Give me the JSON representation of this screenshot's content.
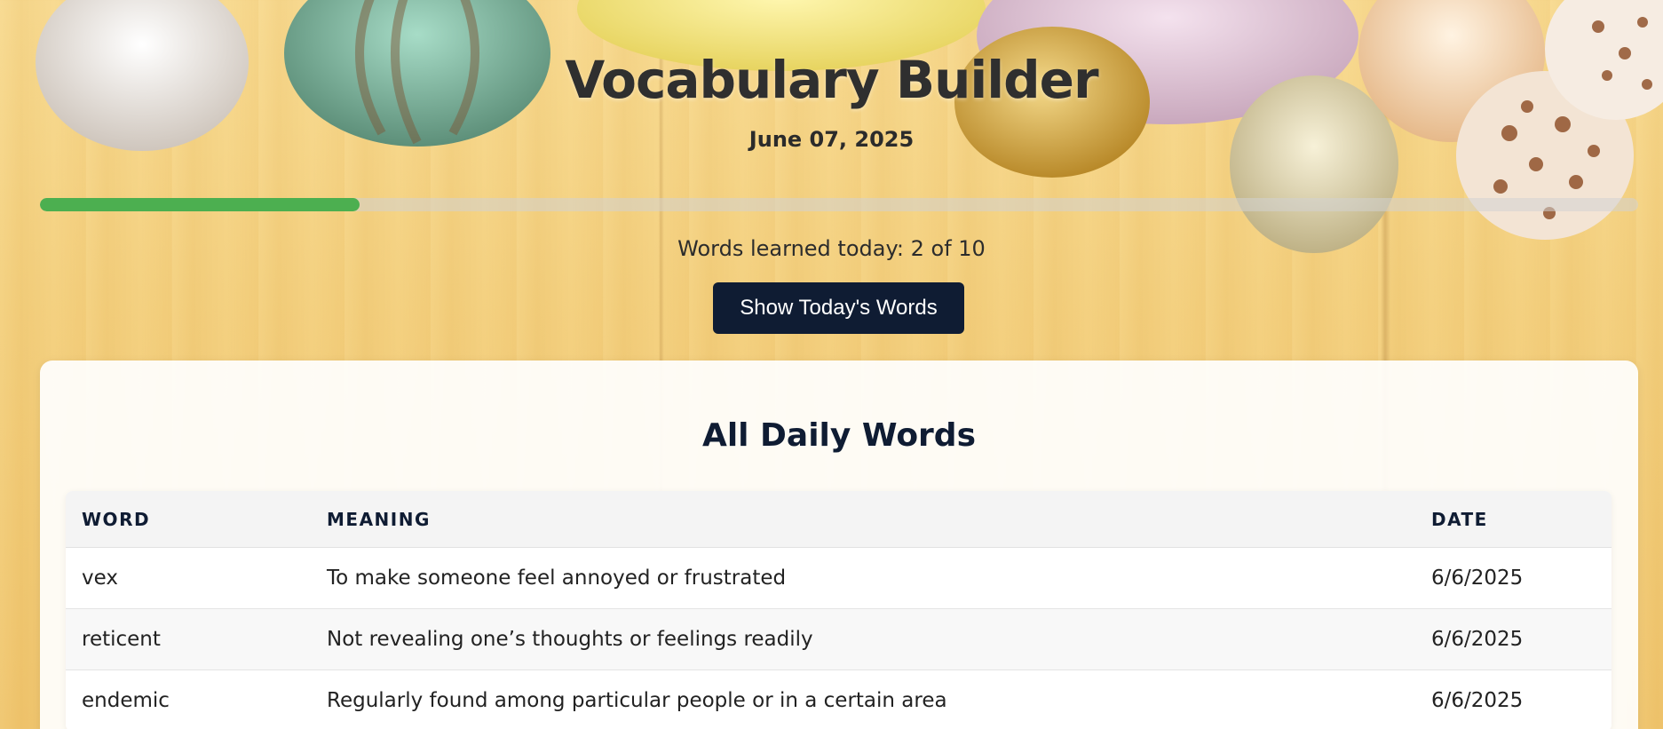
{
  "app": {
    "title": "Vocabulary Builder",
    "date": "June 07, 2025"
  },
  "progress": {
    "learned": 2,
    "total": 10,
    "fraction": 0.2,
    "label": "Words learned today: 2 of 10",
    "fill_color": "#4caf50"
  },
  "actions": {
    "show_words_label": "Show Today's Words"
  },
  "words_section": {
    "title": "All Daily Words",
    "columns": [
      "WORD",
      "MEANING",
      "DATE"
    ],
    "rows": [
      {
        "word": "vex",
        "meaning": "To make someone feel annoyed or frustrated",
        "date": "6/6/2025"
      },
      {
        "word": "reticent",
        "meaning": "Not revealing one’s thoughts or feelings readily",
        "date": "6/6/2025"
      },
      {
        "word": "endemic",
        "meaning": "Regularly found among particular people or in a certain area",
        "date": "6/6/2025"
      }
    ]
  },
  "colors": {
    "accent_dark": "#0f1c33",
    "progress_green": "#4caf50"
  }
}
